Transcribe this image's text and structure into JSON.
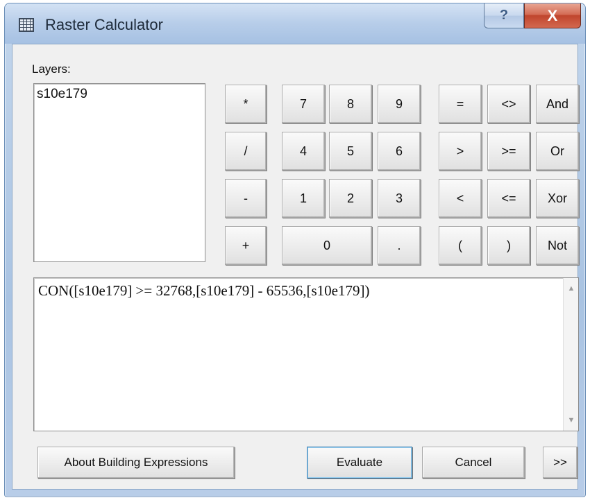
{
  "window": {
    "title": "Raster Calculator",
    "help_label": "?",
    "close_label": "X"
  },
  "layers": {
    "label": "Layers:",
    "items": [
      "s10e179"
    ]
  },
  "keypad": {
    "mult": "*",
    "divide": "/",
    "minus": "-",
    "plus": "+",
    "d7": "7",
    "d8": "8",
    "d9": "9",
    "d4": "4",
    "d5": "5",
    "d6": "6",
    "d1": "1",
    "d2": "2",
    "d3": "3",
    "d0": "0",
    "decimal": ".",
    "eq": "=",
    "neq": "<>",
    "and": "And",
    "gt": ">",
    "gte": ">=",
    "or": "Or",
    "lt": "<",
    "lte": "<=",
    "xor": "Xor",
    "lparen": "(",
    "rparen": ")",
    "not": "Not"
  },
  "expression": {
    "value": "CON([s10e179] >= 32768,[s10e179] - 65536,[s10e179])"
  },
  "footer": {
    "about": "About Building Expressions",
    "evaluate": "Evaluate",
    "cancel": "Cancel",
    "more": ">>"
  }
}
